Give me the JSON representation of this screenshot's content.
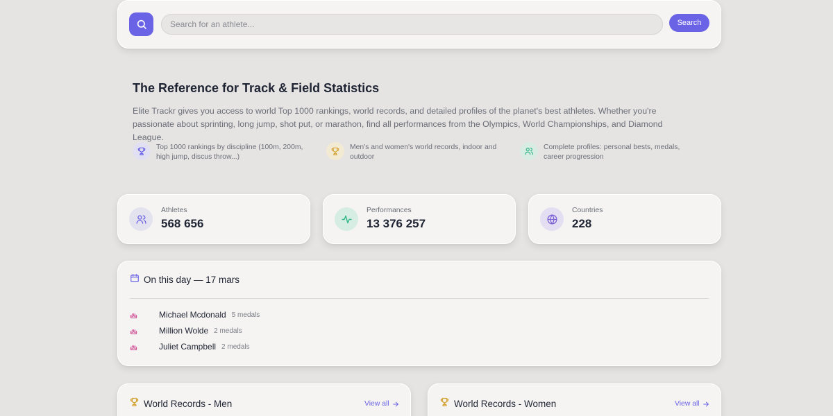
{
  "search": {
    "placeholder": "Search for an athlete...",
    "button_label": "Search"
  },
  "hero": {
    "title": "The Reference for Track & Field Statistics",
    "description": "Elite Trackr gives you access to world Top 1000 rankings, world records, and detailed profiles of the planet's best athletes. Whether you're passionate about sprinting, long jump, shot put, or marathon, find all performances from the Olympics, World Championships, and Diamond League.",
    "features": [
      {
        "text": "Top 1000 rankings by discipline (100m, 200m, high jump, discus throw...)",
        "icon": "trophy-icon"
      },
      {
        "text": "Men's and women's world records, indoor and outdoor",
        "icon": "medal-icon"
      },
      {
        "text": "Complete profiles: personal bests, medals, career progression",
        "icon": "users-icon"
      }
    ]
  },
  "stats": [
    {
      "label": "Athletes",
      "value": "568 656",
      "icon": "users-icon"
    },
    {
      "label": "Performances",
      "value": "13 376 257",
      "icon": "activity-icon"
    },
    {
      "label": "Countries",
      "value": "228",
      "icon": "globe-icon"
    }
  ],
  "on_this_day": {
    "title": "On this day — 17 mars",
    "athletes": [
      {
        "name": "Michael Mcdonald",
        "medals": "5 medals"
      },
      {
        "name": "Million Wolde",
        "medals": "2 medals"
      },
      {
        "name": "Juliet Campbell",
        "medals": "2 medals"
      }
    ]
  },
  "records": {
    "men_title": "World Records - Men",
    "women_title": "World Records - Women",
    "view_all_label": "View all"
  },
  "colors": {
    "accent": "#6b63e6",
    "background": "#e6e4e3",
    "card": "#f5f4f2",
    "trophy_gold": "#d6a53a",
    "cake_pink": "#d1559a",
    "activity_green": "#2fb587"
  }
}
